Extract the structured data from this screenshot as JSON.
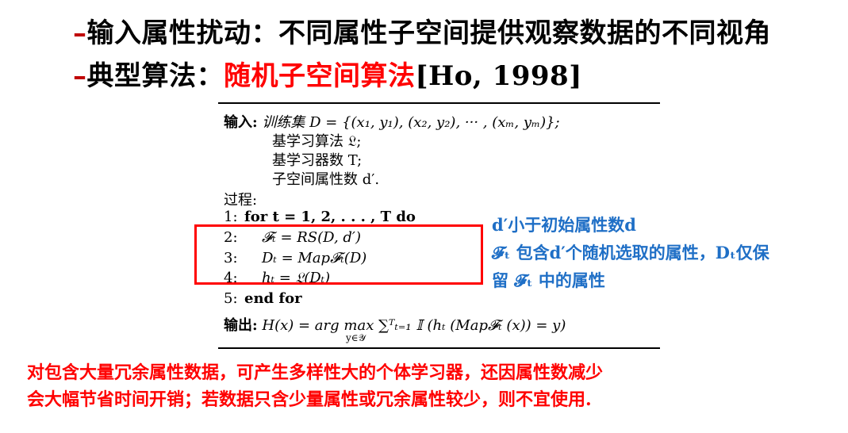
{
  "heading1": {
    "dash": "–",
    "text": "输入属性扰动：不同属性子空间提供观察数据的不同视角"
  },
  "heading2": {
    "dash": "–",
    "prefix": "典型算法：",
    "highlight": "随机子空间算法",
    "cite": "[Ho, 1998]"
  },
  "algorithm": {
    "input_label": "输入:",
    "input_lines": [
      "训练集 D = {(x₁, y₁), (x₂, y₂), ··· , (xₘ, yₘ)};",
      "基学习算法 𝔏;",
      "基学习器数 T;",
      "子空间属性数 d′."
    ],
    "process_label": "过程:",
    "steps": [
      {
        "num": "1:",
        "text": "for t = 1, 2, . . . , T do"
      },
      {
        "num": "2:",
        "text": "𝓕ₜ = RS(D, d′)"
      },
      {
        "num": "3:",
        "text": "Dₜ = Map𝓕ₜ(D)"
      },
      {
        "num": "4:",
        "text": "hₜ = 𝔏(Dₜ)"
      },
      {
        "num": "5:",
        "text": "end for"
      }
    ],
    "output_label": "输出:",
    "output_formula": "H(x) = arg max ∑ᵀₜ₌₁ 𝕀 (hₜ (Map𝓕ₜ (x)) = y)",
    "output_sub": "y∈𝒴"
  },
  "notes": [
    "d′小于初始属性数d",
    "𝓕ₜ 包含d′个随机选取的属性，Dₜ仅保",
    "留 𝓕ₜ 中的属性"
  ],
  "footer": [
    "对包含大量冗余属性数据，可产生多样性大的个体学习器，还因属性数减少",
    "会大幅节省时间开销；若数据只含少量属性或冗余属性较少，则不宜使用."
  ]
}
